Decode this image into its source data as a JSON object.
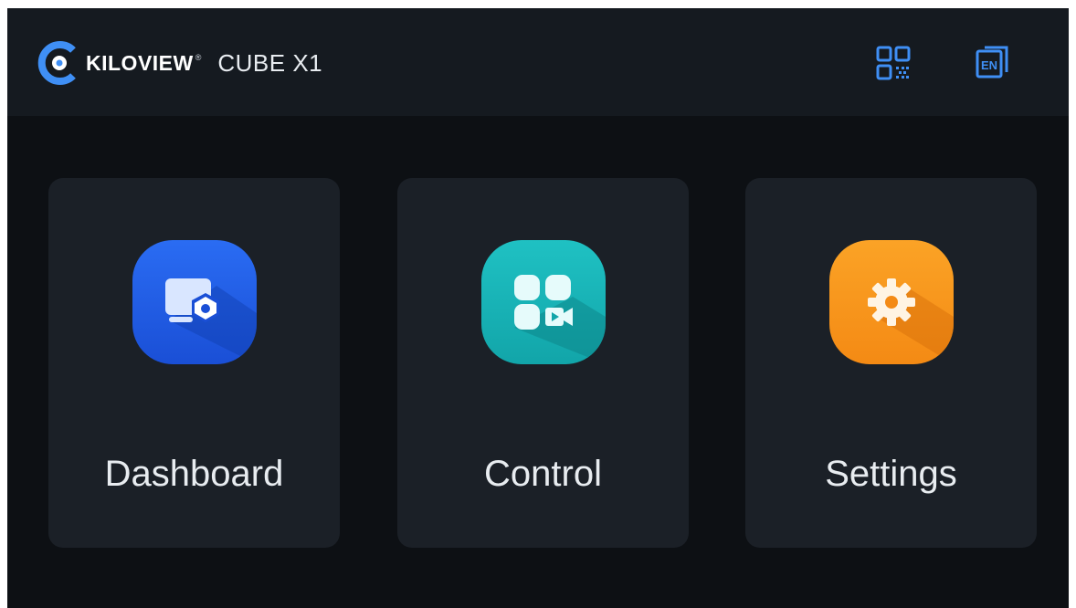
{
  "header": {
    "brand": "KILOVIEW",
    "brand_registered": "®",
    "product": "CUBE X1",
    "qr_icon": "qr-code-icon",
    "language_icon": "language-en-icon",
    "language_code": "EN"
  },
  "cards": [
    {
      "label": "Dashboard",
      "icon": "dashboard-monitor-icon",
      "color": "#1f5ee8"
    },
    {
      "label": "Control",
      "icon": "control-grid-video-icon",
      "color": "#16b5b8"
    },
    {
      "label": "Settings",
      "icon": "settings-gear-icon",
      "color": "#f7981d"
    }
  ],
  "colors": {
    "accent": "#3f8ff5",
    "background": "#0d1014",
    "card": "#1b2027"
  }
}
